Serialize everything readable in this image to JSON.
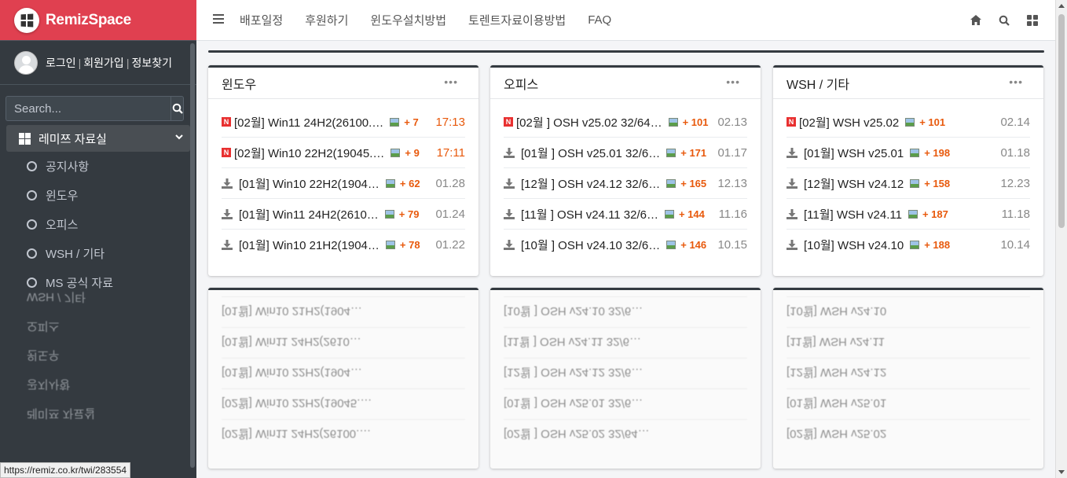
{
  "brand": {
    "name": "RemizSpace"
  },
  "user": {
    "login": "로그인",
    "signup": "회원가입",
    "find": "정보찾기",
    "sep": "|"
  },
  "search": {
    "placeholder": "Search..."
  },
  "sidebar": {
    "parent": "레미쯔 자료실",
    "items": [
      {
        "label": "공지사항"
      },
      {
        "label": "윈도우"
      },
      {
        "label": "오피스"
      },
      {
        "label": "WSH / 기타"
      },
      {
        "label": "MS 공식 자료"
      }
    ]
  },
  "topnav": {
    "links": [
      "배포일정",
      "후원하기",
      "윈도우설치방법",
      "토렌트자료이용방법",
      "FAQ"
    ]
  },
  "status_url": "https://remiz.co.kr/twi/283554",
  "cards": [
    {
      "title": "윈도우",
      "more": "•••",
      "rows": [
        {
          "badge": "N",
          "title": "[02월] Win11 24H2(26100.…",
          "comments": "+ 7",
          "date": "17:13",
          "today": true
        },
        {
          "badge": "N",
          "title": "[02월] Win10 22H2(19045.…",
          "comments": "+ 9",
          "date": "17:11",
          "today": true
        },
        {
          "badge": "",
          "title": "[01월] Win10 22H2(1904…",
          "comments": "+ 62",
          "date": "01.28",
          "today": false
        },
        {
          "badge": "",
          "title": "[01월] Win11 24H2(2610…",
          "comments": "+ 79",
          "date": "01.24",
          "today": false
        },
        {
          "badge": "",
          "title": "[01월] Win10 21H2(1904…",
          "comments": "+ 78",
          "date": "01.22",
          "today": false
        }
      ]
    },
    {
      "title": "오피스",
      "more": "•••",
      "rows": [
        {
          "badge": "N",
          "title": "[02월 ] OSH v25.02 32/64…",
          "comments": "+ 101",
          "date": "02.13",
          "today": false
        },
        {
          "badge": "",
          "title": "[01월 ] OSH v25.01 32/6…",
          "comments": "+ 171",
          "date": "01.17",
          "today": false
        },
        {
          "badge": "",
          "title": "[12월 ] OSH v24.12 32/6…",
          "comments": "+ 165",
          "date": "12.13",
          "today": false
        },
        {
          "badge": "",
          "title": "[11월 ] OSH v24.11 32/6…",
          "comments": "+ 144",
          "date": "11.16",
          "today": false
        },
        {
          "badge": "",
          "title": "[10월 ] OSH v24.10 32/6…",
          "comments": "+ 146",
          "date": "10.15",
          "today": false
        }
      ]
    },
    {
      "title": "WSH / 기타",
      "more": "•••",
      "rows": [
        {
          "badge": "N",
          "title": "[02월] WSH v25.02",
          "comments": "+ 101",
          "date": "02.14",
          "today": false
        },
        {
          "badge": "",
          "title": "[01월] WSH v25.01",
          "comments": "+ 198",
          "date": "01.18",
          "today": false
        },
        {
          "badge": "",
          "title": "[12월] WSH v24.12",
          "comments": "+ 158",
          "date": "12.23",
          "today": false
        },
        {
          "badge": "",
          "title": "[11월] WSH v24.11",
          "comments": "+ 187",
          "date": "11.18",
          "today": false
        },
        {
          "badge": "",
          "title": "[10월] WSH v24.10",
          "comments": "+ 188",
          "date": "10.14",
          "today": false
        }
      ]
    }
  ],
  "colors": {
    "brand": "#e04050",
    "sidebar": "#343a40",
    "accent": "#e8590c",
    "badge": "#e83030"
  }
}
